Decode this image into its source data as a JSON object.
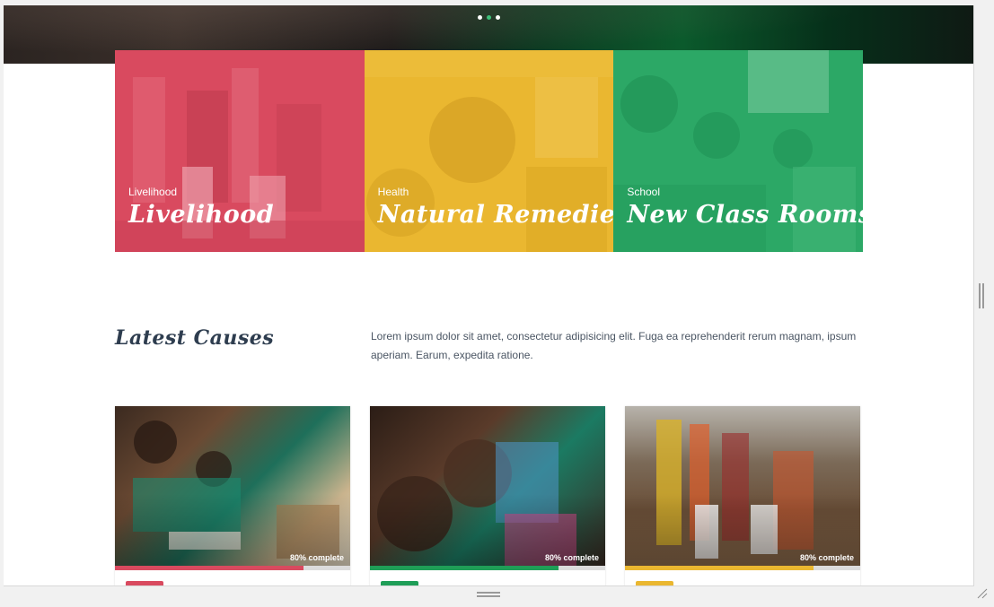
{
  "carousel": {
    "dot_count": 3,
    "active_index": 1
  },
  "categories": [
    {
      "tag": "Livelihood",
      "title": "Livelihood",
      "color": "#d94a5f"
    },
    {
      "tag": "Health",
      "title": "Natural Remedies",
      "color": "#eab730"
    },
    {
      "tag": "School",
      "title": "New Class Rooms",
      "color": "#2ca866"
    }
  ],
  "latest": {
    "title": "Latest Causes",
    "description": "Lorem ipsum dolor sit amet, consectetur adipisicing elit. Fuga ea reprehenderit rerum magnam, ipsum aperiam. Earum, expedita ratione."
  },
  "causes": [
    {
      "progress_label": "80% complete",
      "progress": 0.8,
      "color": "#d94a5f"
    },
    {
      "progress_label": "80% complete",
      "progress": 0.8,
      "color": "#1f9e57"
    },
    {
      "progress_label": "80% complete",
      "progress": 0.8,
      "color": "#eab730"
    }
  ]
}
